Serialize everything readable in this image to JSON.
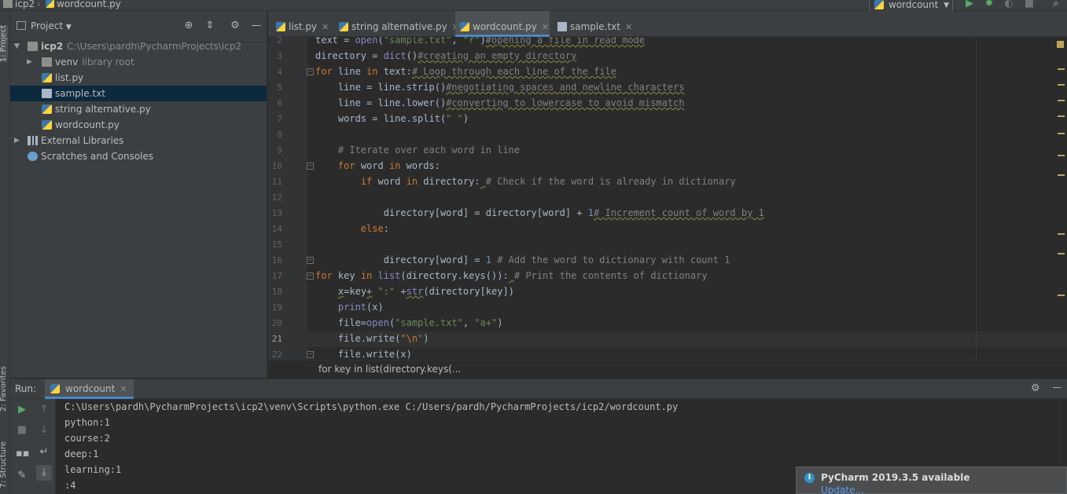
{
  "navbar": {
    "project": "icp2",
    "file": "wordcount.py",
    "run_config": "wordcount"
  },
  "left_stripe": {
    "project_tab": "1: Project",
    "favorites_tab": "2: Favorites",
    "structure_tab": "7: Structure"
  },
  "project_panel": {
    "title": "Project",
    "tree": {
      "root_name": "icp2",
      "root_path": "C:\\Users\\pardh\\PycharmProjects\\icp2",
      "venv": "venv",
      "venv_note": "library root",
      "files": [
        "list.py",
        "sample.txt",
        "string alternative.py",
        "wordcount.py"
      ],
      "external_libraries": "External Libraries",
      "scratches": "Scratches and Consoles"
    }
  },
  "editor": {
    "tabs": [
      {
        "label": "list.py",
        "type": "py"
      },
      {
        "label": "string alternative.py",
        "type": "py"
      },
      {
        "label": "wordcount.py",
        "type": "py"
      },
      {
        "label": "sample.txt",
        "type": "txt"
      }
    ],
    "active_tab": "wordcount.py",
    "line_numbers": [
      "2",
      "3",
      "4",
      "5",
      "6",
      "7",
      "8",
      "9",
      "10",
      "11",
      "12",
      "13",
      "14",
      "15",
      "16",
      "17",
      "18",
      "19",
      "20",
      "21",
      "22"
    ],
    "current_line": "21",
    "breadcrumb": "for key in list(directory.keys(..."
  },
  "run": {
    "label": "Run:",
    "tab": "wordcount",
    "console": [
      "C:\\Users\\pardh\\PycharmProjects\\icp2\\venv\\Scripts\\python.exe C:/Users/pardh/PycharmProjects/icp2/wordcount.py",
      "python:1",
      "course:2",
      "deep:1",
      "learning:1",
      ":4"
    ]
  },
  "notification": {
    "title": "PyCharm 2019.3.5 available",
    "link": "Update..."
  },
  "colors": {
    "keyword": "#cc7832",
    "string": "#6a8759",
    "comment": "#808080",
    "number": "#6897bb",
    "accent": "#4a88c7",
    "selection": "#0d293e"
  },
  "icons": [
    "folder-icon",
    "python-file-icon",
    "text-file-icon",
    "run-icon",
    "debug-icon",
    "gear-icon",
    "search-icon",
    "info-icon"
  ]
}
